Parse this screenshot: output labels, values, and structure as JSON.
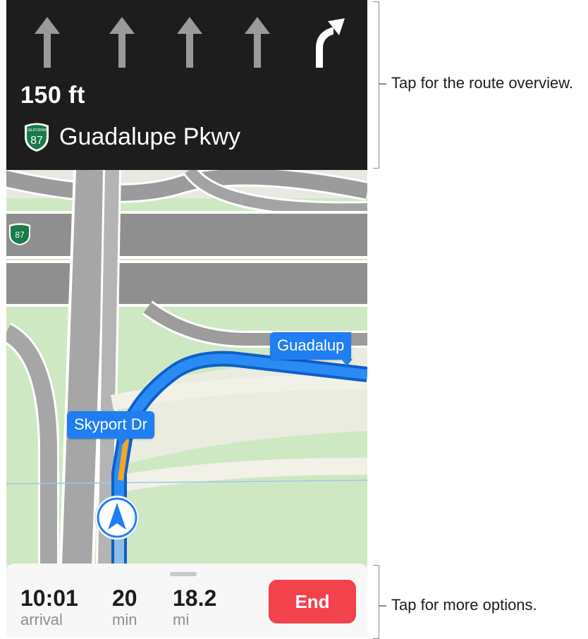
{
  "navigation": {
    "lanes": [
      "straight-arrow-icon",
      "straight-arrow-icon",
      "straight-arrow-icon",
      "straight-arrow-icon",
      "turn-right-arrow-icon"
    ],
    "distance": "150 ft",
    "route_shield_number": "87",
    "route_shield_state": "CALIFORNIA",
    "street": "Guadalupe Pkwy"
  },
  "map": {
    "shield_number": "87",
    "labels": {
      "current_street": "Skyport Dr",
      "next_street": "Guadalup"
    }
  },
  "trip": {
    "arrival_value": "10:01",
    "arrival_label": "arrival",
    "time_value": "20",
    "time_label": "min",
    "distance_value": "18.2",
    "distance_label": "mi",
    "end_label": "End"
  },
  "annotations": {
    "top": "Tap for the route overview.",
    "bottom": "Tap for more options."
  },
  "colors": {
    "banner": "#1d1d1d",
    "route_blue": "#1f7ef2",
    "end_red": "#f2424b",
    "land_green": "#cfe8c4",
    "road_gray": "#8f8f8f"
  }
}
